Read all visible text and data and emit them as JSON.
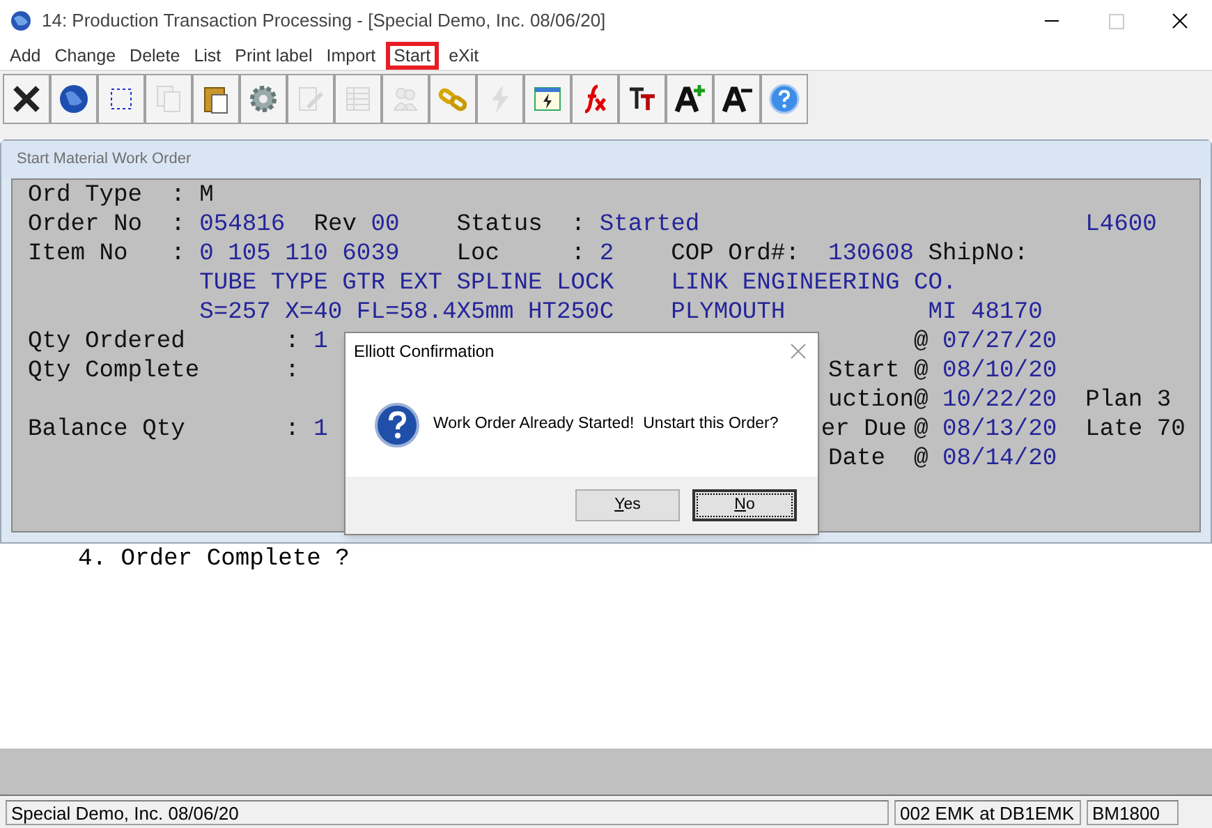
{
  "window": {
    "title": "14: Production Transaction Processing - [Special Demo, Inc. 08/06/20]"
  },
  "menu": [
    {
      "label": "Add",
      "outlined": false
    },
    {
      "label": "Change",
      "outlined": false
    },
    {
      "label": "Delete",
      "outlined": false
    },
    {
      "label": "List",
      "outlined": false
    },
    {
      "label": "Print label",
      "outlined": false
    },
    {
      "label": "Import",
      "outlined": false
    },
    {
      "label": "Start",
      "outlined": true
    },
    {
      "label": "eXit",
      "outlined": false
    }
  ],
  "toolbar": [
    {
      "kind": "close",
      "disabled": false
    },
    {
      "kind": "globe",
      "disabled": false
    },
    {
      "kind": "select",
      "disabled": false
    },
    {
      "kind": "copy",
      "disabled": true
    },
    {
      "kind": "paste",
      "disabled": false
    },
    {
      "kind": "gear",
      "disabled": false
    },
    {
      "kind": "edit",
      "disabled": true
    },
    {
      "kind": "table",
      "disabled": true
    },
    {
      "kind": "people",
      "disabled": true
    },
    {
      "kind": "link",
      "disabled": false
    },
    {
      "kind": "bolt",
      "disabled": true
    },
    {
      "kind": "window",
      "disabled": false
    },
    {
      "kind": "fx",
      "disabled": false
    },
    {
      "kind": "tt",
      "disabled": false
    },
    {
      "kind": "grow",
      "disabled": false
    },
    {
      "kind": "shrink",
      "disabled": false
    },
    {
      "kind": "help",
      "disabled": false
    }
  ],
  "form": {
    "title": "Start Material Work Order",
    "lines": [
      [
        {
          "text": "Ord Type",
          "kind": "label"
        },
        {
          "text": ":",
          "kind": "label"
        },
        {
          "text": "M",
          "kind": "label"
        }
      ],
      [
        {
          "text": "Order No",
          "kind": "label"
        },
        {
          "text": ":",
          "kind": "label"
        },
        {
          "text": "054816",
          "kind": "value"
        },
        {
          "text": "Rev",
          "kind": "label"
        },
        {
          "text": "00",
          "kind": "value"
        },
        {
          "text": "Status",
          "kind": "label"
        },
        {
          "text": ":",
          "kind": "label"
        },
        {
          "text": "Started",
          "kind": "value"
        },
        {
          "text": "L4600",
          "kind": "value"
        }
      ],
      [
        {
          "text": "Item No",
          "kind": "label"
        },
        {
          "text": ":",
          "kind": "label"
        },
        {
          "text": "0 105 110 6039",
          "kind": "value"
        },
        {
          "text": "Loc",
          "kind": "label"
        },
        {
          "text": ":",
          "kind": "label"
        },
        {
          "text": "2",
          "kind": "value"
        },
        {
          "text": "COP Ord#:",
          "kind": "label"
        },
        {
          "text": "130608",
          "kind": "value"
        },
        {
          "text": "ShipNo:",
          "kind": "label"
        }
      ],
      [
        {
          "text": "TUBE TYPE GTR EXT SPLINE LOCK",
          "kind": "value"
        },
        {
          "text": "LINK ENGINEERING CO.",
          "kind": "value"
        }
      ],
      [
        {
          "text": "S=257 X=40 FL=58.4X5mm HT250C",
          "kind": "value"
        },
        {
          "text": "PLYMOUTH",
          "kind": "value"
        },
        {
          "text": "MI 48170",
          "kind": "value"
        }
      ],
      [
        {
          "text": "Qty Ordered",
          "kind": "label"
        },
        {
          "text": ":",
          "kind": "label"
        },
        {
          "text": "1",
          "kind": "value"
        },
        {
          "text": "@",
          "kind": "label"
        },
        {
          "text": "07/27/20",
          "kind": "value"
        }
      ],
      [
        {
          "text": "Qty Complete",
          "kind": "label"
        },
        {
          "text": ":",
          "kind": "label"
        },
        {
          "text": "Start",
          "kind": "label"
        },
        {
          "text": "@",
          "kind": "label"
        },
        {
          "text": "08/10/20",
          "kind": "value"
        }
      ],
      [
        {
          "text": "uction@",
          "kind": "label"
        },
        {
          "text": "10/22/20",
          "kind": "value"
        },
        {
          "text": "Plan 3",
          "kind": "label"
        }
      ],
      [
        {
          "text": "Balance Qty",
          "kind": "label"
        },
        {
          "text": ":",
          "kind": "label"
        },
        {
          "text": "1",
          "kind": "value"
        },
        {
          "text": "er Due",
          "kind": "label"
        },
        {
          "text": "@",
          "kind": "label"
        },
        {
          "text": "08/13/20",
          "kind": "value"
        },
        {
          "text": "Late 70",
          "kind": "label"
        }
      ],
      [
        {
          "text": "Date",
          "kind": "label"
        },
        {
          "text": "@",
          "kind": "label"
        },
        {
          "text": "08/14/20",
          "kind": "value"
        }
      ]
    ]
  },
  "prompt": "4. Order Complete ?",
  "dialog": {
    "title": "Elliott Confirmation",
    "message": "Work Order Already Started!  Unstart this Order?",
    "buttons": [
      {
        "label": "Yes",
        "focused": false
      },
      {
        "label": "No",
        "focused": true
      }
    ]
  },
  "status_bar": [
    "Special Demo, Inc. 08/06/20",
    "002 EMK at DB1EMK",
    "BM1800"
  ]
}
